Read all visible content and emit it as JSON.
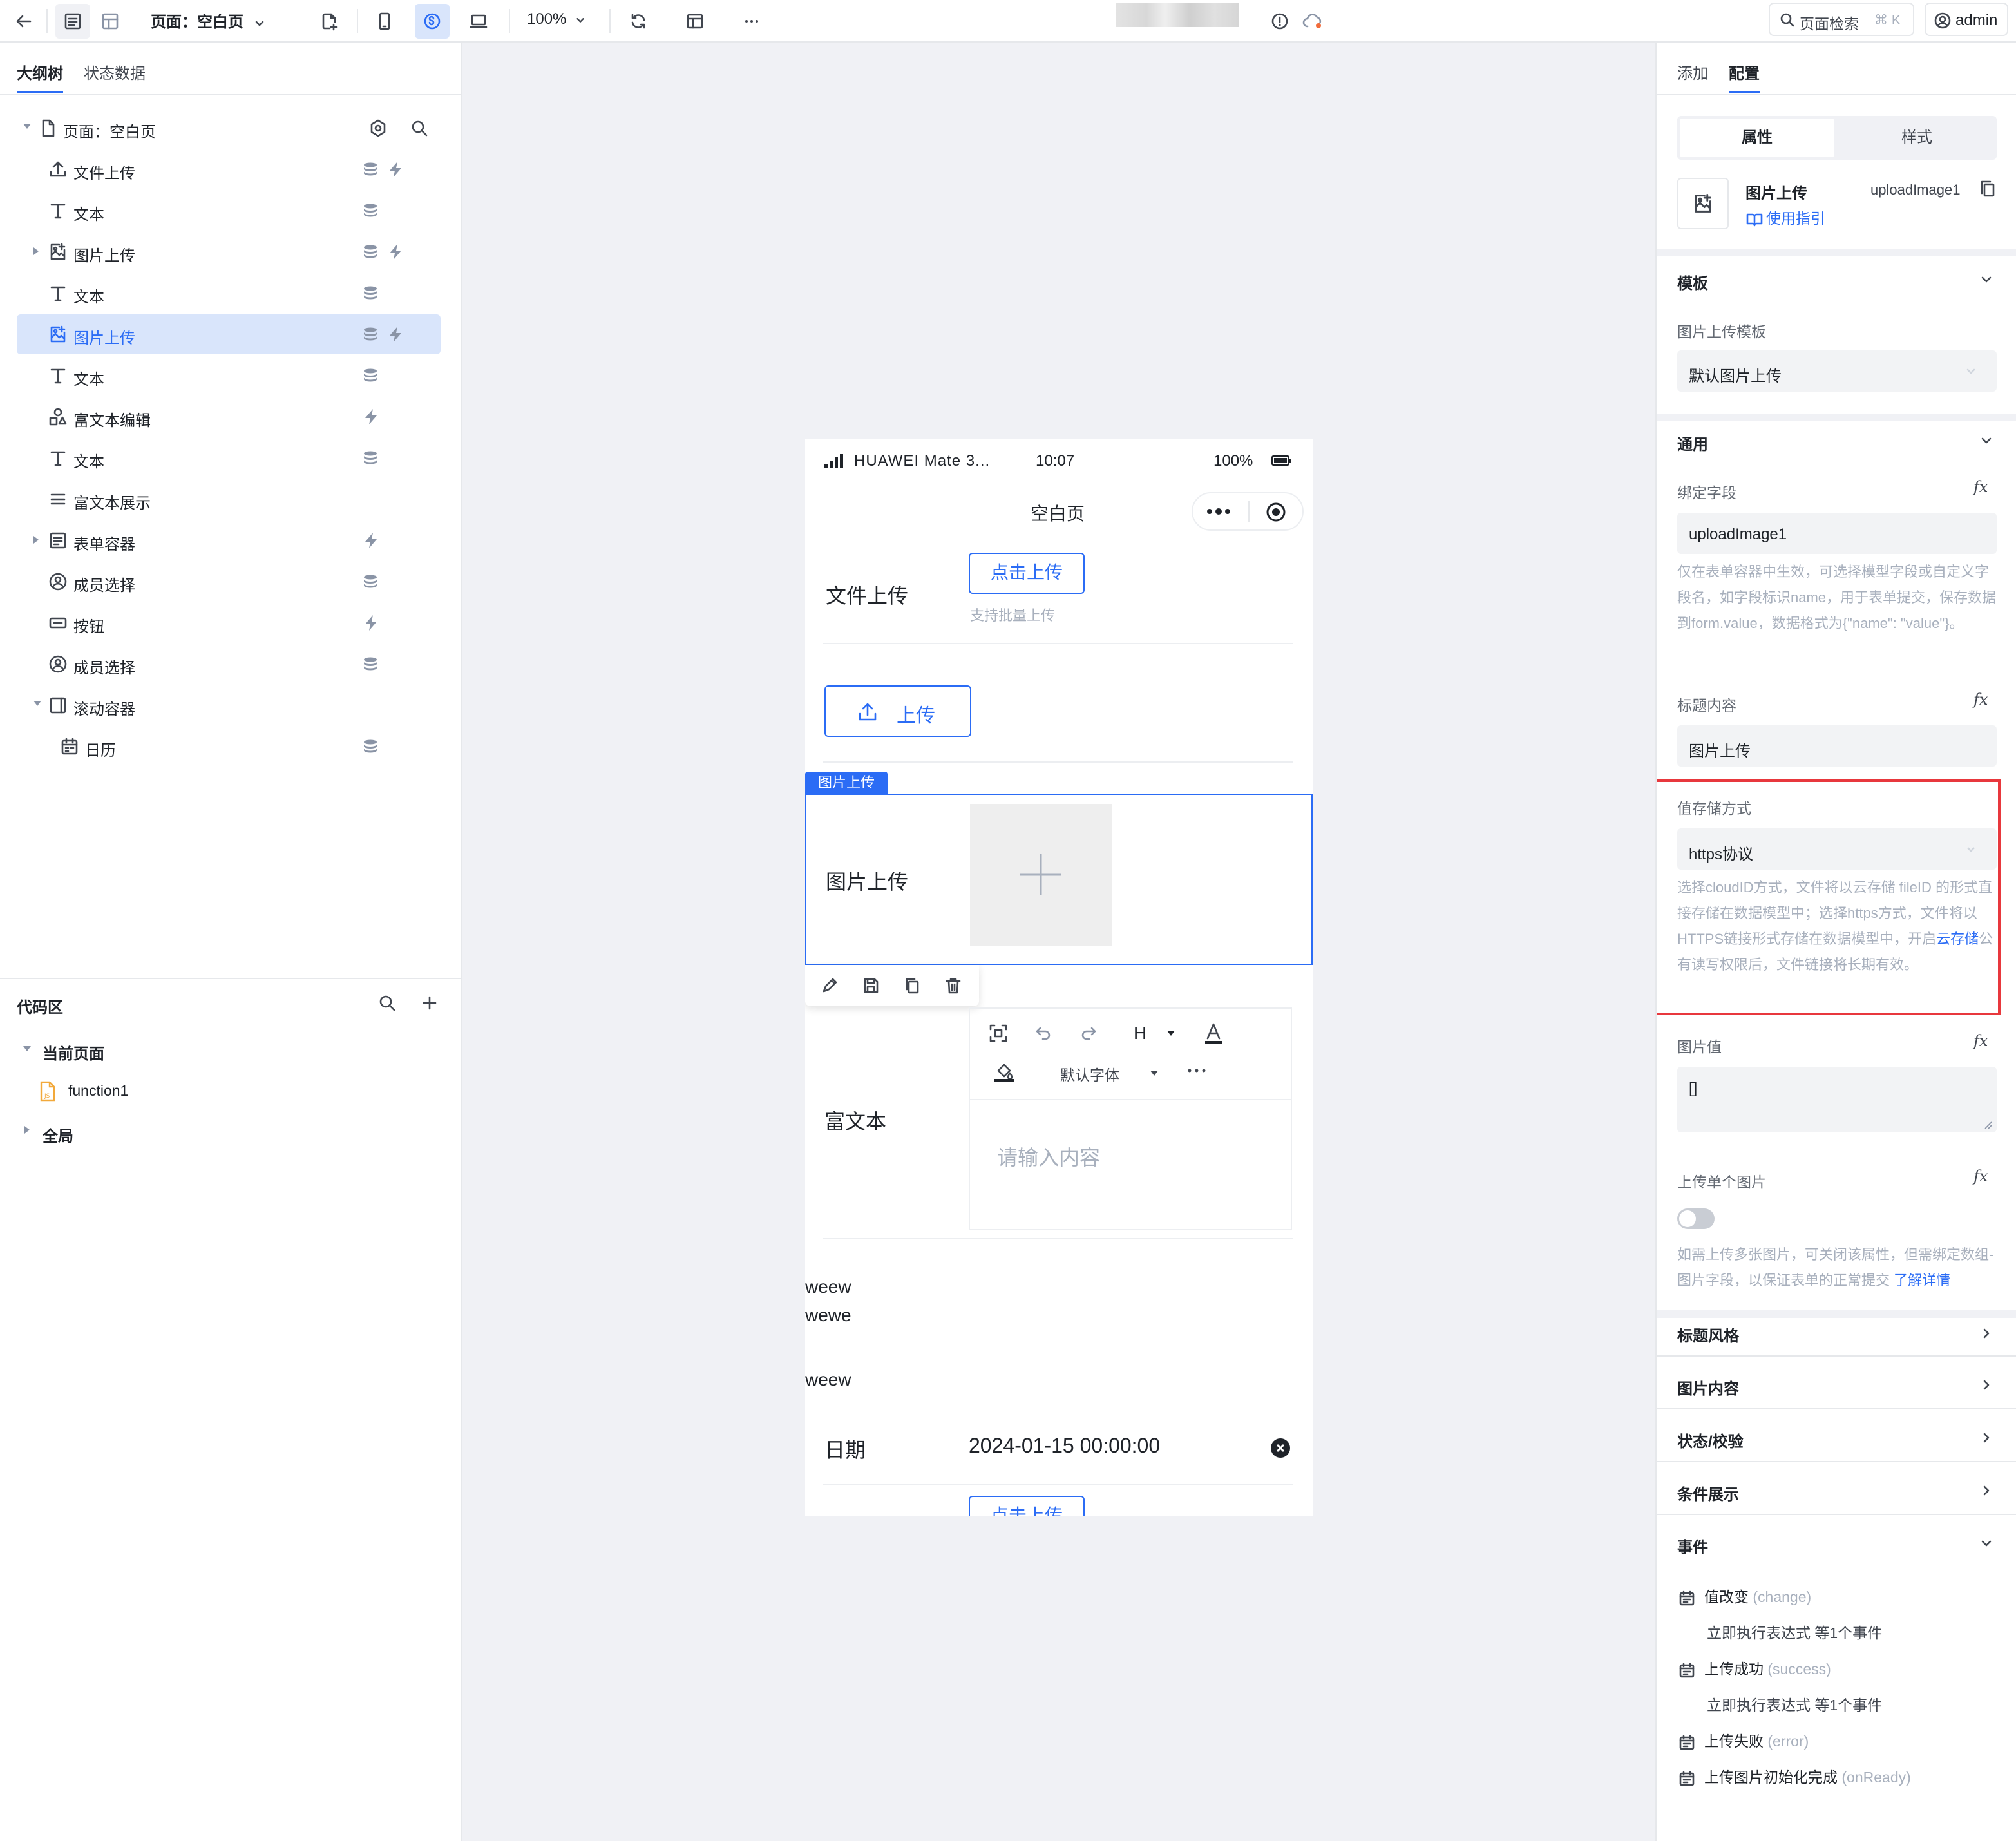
{
  "topbar": {
    "page_label": "页面：空白页",
    "zoom": "100%",
    "search_label": "页面检索",
    "search_shortcut": "⌘ K",
    "user": "admin"
  },
  "left": {
    "tabs": [
      "大纲树",
      "状态数据"
    ],
    "tree": [
      {
        "label": "页面：空白页",
        "icon": "page-icon"
      },
      {
        "label": "文件上传",
        "icon": "upload-icon"
      },
      {
        "label": "文本",
        "icon": "text-icon"
      },
      {
        "label": "图片上传",
        "icon": "image-upload-icon"
      },
      {
        "label": "文本",
        "icon": "text-icon"
      },
      {
        "label": "图片上传",
        "icon": "image-upload-icon"
      },
      {
        "label": "文本",
        "icon": "text-icon"
      },
      {
        "label": "富文本编辑",
        "icon": "shapes-icon"
      },
      {
        "label": "文本",
        "icon": "text-icon"
      },
      {
        "label": "富文本展示",
        "icon": "lines-icon"
      },
      {
        "label": "表单容器",
        "icon": "form-icon"
      },
      {
        "label": "成员选择",
        "icon": "user-circle-icon"
      },
      {
        "label": "按钮",
        "icon": "button-icon"
      },
      {
        "label": "成员选择",
        "icon": "user-circle-icon"
      },
      {
        "label": "滚动容器",
        "icon": "scroll-icon"
      },
      {
        "label": "日历",
        "icon": "calendar-icon"
      }
    ],
    "code": {
      "title": "代码区",
      "current_page": "当前页面",
      "function": "function1",
      "global": "全局"
    }
  },
  "phone": {
    "carrier": "HUAWEI Mate 3...",
    "time": "10:07",
    "battery": "100%",
    "page_title": "空白页",
    "file_upload_label": "文件上传",
    "click_upload": "点击上传",
    "batch_hint": "支持批量上传",
    "upload_btn": "上传",
    "img_tag": "图片上传",
    "img_label": "图片上传",
    "richtext_label": "富文本",
    "font_default": "默认字体",
    "heading_btn": "H",
    "richtext_placeholder": "请输入内容",
    "texts": [
      "weew",
      "wewe",
      "weew"
    ],
    "date_label": "日期",
    "date_value": "2024-01-15 00:00:00",
    "click_upload_bottom": "点击上传"
  },
  "right": {
    "tabs": [
      "添加",
      "配置"
    ],
    "segments": [
      "属性",
      "样式"
    ],
    "component_name": "图片上传",
    "component_id": "uploadImage1",
    "guide": "使用指引",
    "template_section": "模板",
    "template_label": "图片上传模板",
    "template_value": "默认图片上传",
    "general_section": "通用",
    "bind_label": "绑定字段",
    "bind_value": "uploadImage1",
    "bind_help": "仅在表单容器中生效，可选择模型字段或自定义字段名，如字段标识name，用于表单提交，保存数据到form.value，数据格式为{\"name\": \"value\"}。",
    "title_label": "标题内容",
    "title_value": "图片上传",
    "storage_label": "值存储方式",
    "storage_value": "https协议",
    "storage_help_1": "选择cloudID方式，文件将以云存储 fileID 的形式直接存储在数据模型中；选择https方式，文件将以HTTPS链接形式存储在数据模型中，开启",
    "storage_help_link": "云存储",
    "storage_help_2": "公有读写权限后，文件链接将长期有效。",
    "image_value_label": "图片值",
    "image_value": "[]",
    "single_label": "上传单个图片",
    "single_help": "如需上传多张图片，可关闭该属性，但需绑定数组-图片字段，以保证表单的正常提交",
    "single_help_link": "了解详情",
    "collapsed_sections": [
      "标题风格",
      "图片内容",
      "状态/校验",
      "条件展示"
    ],
    "events_section": "事件",
    "events": [
      {
        "name": "值改变",
        "code": "(change)",
        "sub": "立即执行表达式 等1个事件"
      },
      {
        "name": "上传成功",
        "code": "(success)",
        "sub": "立即执行表达式 等1个事件"
      },
      {
        "name": "上传失败",
        "code": "(error)",
        "sub": ""
      },
      {
        "name": "上传图片初始化完成",
        "code": "(onReady)",
        "sub": ""
      }
    ],
    "fx": "fx",
    "highlight_color": "#e8383d"
  }
}
